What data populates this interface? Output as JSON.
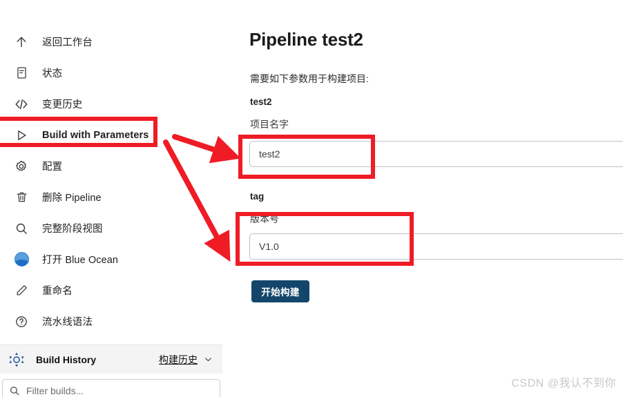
{
  "sidebar": {
    "items": [
      {
        "label": "返回工作台",
        "icon": "arrow-up-icon",
        "bold": false
      },
      {
        "label": "状态",
        "icon": "document-status-icon",
        "bold": false
      },
      {
        "label": "变更历史",
        "icon": "code-brackets-icon",
        "bold": false
      },
      {
        "label": "Build with Parameters",
        "icon": "play-triangle-icon",
        "bold": true
      },
      {
        "label": "配置",
        "icon": "gear-icon",
        "bold": false
      },
      {
        "label": "删除 Pipeline",
        "icon": "trash-icon",
        "bold": false
      },
      {
        "label": "完整阶段视图",
        "icon": "search-icon",
        "bold": false
      },
      {
        "label": "打开 Blue Ocean",
        "icon": "blue-ocean-icon",
        "bold": false
      },
      {
        "label": "重命名",
        "icon": "pencil-icon",
        "bold": false
      },
      {
        "label": "流水线语法",
        "icon": "question-circle-icon",
        "bold": false
      }
    ],
    "build_history": {
      "icon": "jenkins-sun-icon",
      "title": "Build History",
      "link_label": "构建历史",
      "chevron": "chevron-down-icon"
    },
    "filter": {
      "icon": "search-icon",
      "placeholder": "Filter builds..."
    }
  },
  "main": {
    "title": "Pipeline test2",
    "intro": "需要如下参数用于构建项目:",
    "parameters": [
      {
        "name": "test2",
        "description": "项目名字",
        "value": "test2"
      },
      {
        "name": "tag",
        "description": "版本号",
        "value": "V1.0"
      }
    ],
    "build_button_label": "开始构建"
  },
  "annotations": {
    "color": "#ef1c26",
    "boxes": [
      "build-with-parameters",
      "project-name-input",
      "tag-input"
    ],
    "arrows": 2
  },
  "watermark": "CSDN @我认不到你"
}
